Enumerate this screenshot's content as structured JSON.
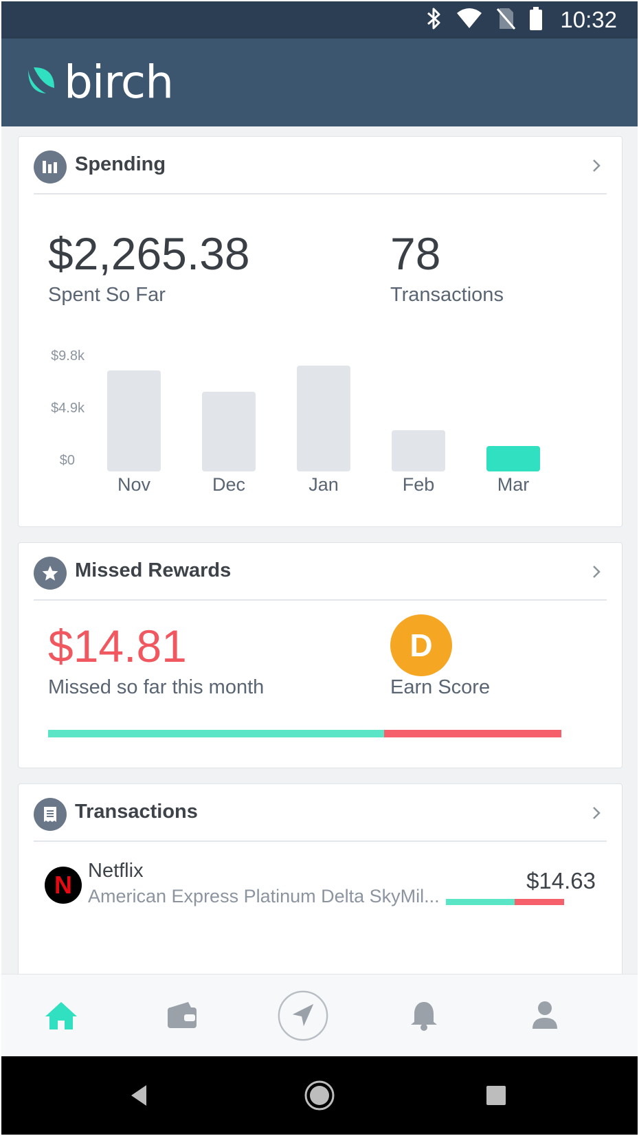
{
  "status_bar": {
    "time": "10:32",
    "icons": [
      "bluetooth-icon",
      "wifi-icon",
      "no-sim-icon",
      "battery-icon"
    ]
  },
  "app": {
    "brand": "birch",
    "brand_color": "#30e0c0",
    "header_color": "#3d566f"
  },
  "spending": {
    "title": "Spending",
    "amount": "$2,265.38",
    "amount_label": "Spent So Far",
    "count": "78",
    "count_label": "Transactions",
    "chart_data": {
      "type": "bar",
      "categories": [
        "Nov",
        "Dec",
        "Jan",
        "Feb",
        "Mar"
      ],
      "values": [
        8400,
        6600,
        8800,
        3400,
        2100
      ],
      "ylim": [
        0,
        9800
      ],
      "yticks": [
        "$9.8k",
        "$4.9k",
        "$0"
      ],
      "highlight_index": 4,
      "highlight_color": "#30e0c0",
      "bar_color": "#e1e4e8"
    }
  },
  "missed_rewards": {
    "title": "Missed Rewards",
    "amount": "$14.81",
    "amount_label": "Missed so far this month",
    "grade": "D",
    "grade_label": "Earn Score",
    "progress": {
      "earned_fraction": 0.655,
      "earned_color": "#5ae6c6",
      "missed_color": "#f5606a"
    }
  },
  "transactions": {
    "title": "Transactions",
    "items": [
      {
        "merchant": "Netflix",
        "logo_letter": "N",
        "card": "American Express Platinum Delta SkyMil...",
        "amount": "$14.63",
        "earned_fraction": 0.58
      }
    ]
  },
  "nav": {
    "items": [
      "home-icon",
      "wallet-icon",
      "navigate-icon",
      "bell-icon",
      "profile-icon"
    ],
    "active": "home-icon",
    "active_color": "#30e0c0",
    "inactive_color": "#9aa1a9"
  }
}
